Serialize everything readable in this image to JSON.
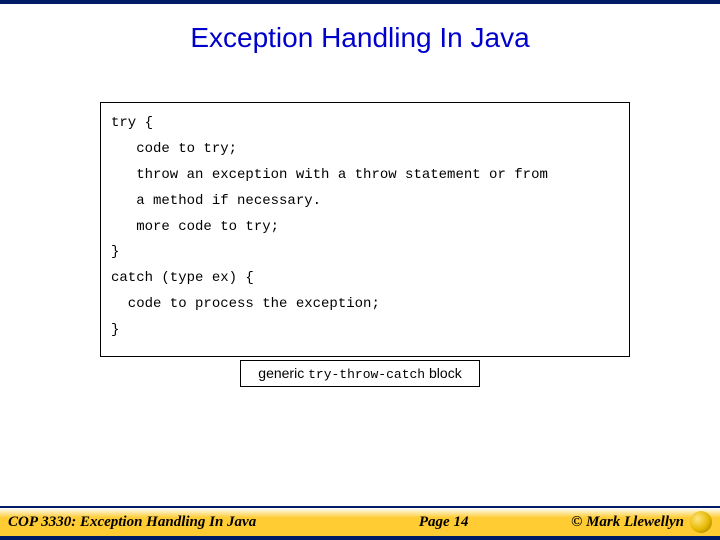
{
  "title": "Exception Handling In Java",
  "code": {
    "l1": "try {",
    "l2": "   code to try;",
    "l3": "   throw an exception with a throw statement or from",
    "l4": "   a method if necessary.",
    "l5": "   more code to try;",
    "l6": "}",
    "l7": "catch (type ex) {",
    "l8": "  code to process the exception;",
    "l9": "}"
  },
  "caption": {
    "prefix": "generic ",
    "mono": "try-throw-catch",
    "suffix": " block"
  },
  "footer": {
    "left": "COP 3330:  Exception Handling In Java",
    "mid": "Page 14",
    "right": "© Mark Llewellyn"
  }
}
